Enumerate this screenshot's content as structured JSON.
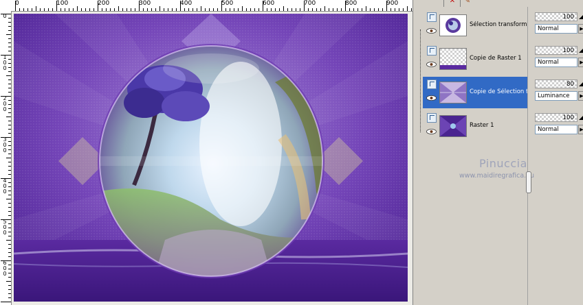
{
  "ruler": {
    "top_labels": [
      "0",
      "100",
      "200",
      "300",
      "400",
      "500",
      "600",
      "700",
      "800",
      "900"
    ],
    "left_labels": [
      "0",
      "1 0 0",
      "2 0 0",
      "3 0 0",
      "4 0 0",
      "5 0 0",
      "6 0 0"
    ]
  },
  "layers": [
    {
      "name": "Sélection transformée",
      "opacity": "100",
      "blend": "Normal",
      "selected": false,
      "thumb": "orb-icon"
    },
    {
      "name": "Copie de Raster 1",
      "opacity": "100",
      "blend": "Normal",
      "selected": false,
      "thumb": "transparent-strip-icon"
    },
    {
      "name": "Copie de Sélection t",
      "opacity": "80",
      "blend": "Luminance",
      "selected": true,
      "thumb": "x-pattern-icon"
    },
    {
      "name": "Raster 1",
      "opacity": "100",
      "blend": "Normal",
      "selected": false,
      "thumb": "purple-bg-icon"
    }
  ],
  "watermark": {
    "title": "Pinuccia",
    "url": "www.maidiregrafica.eu"
  },
  "colors": {
    "canvas_purple": "#6a35a9",
    "selection_blue": "#316ac5",
    "panel_gray": "#d4d0c8"
  }
}
